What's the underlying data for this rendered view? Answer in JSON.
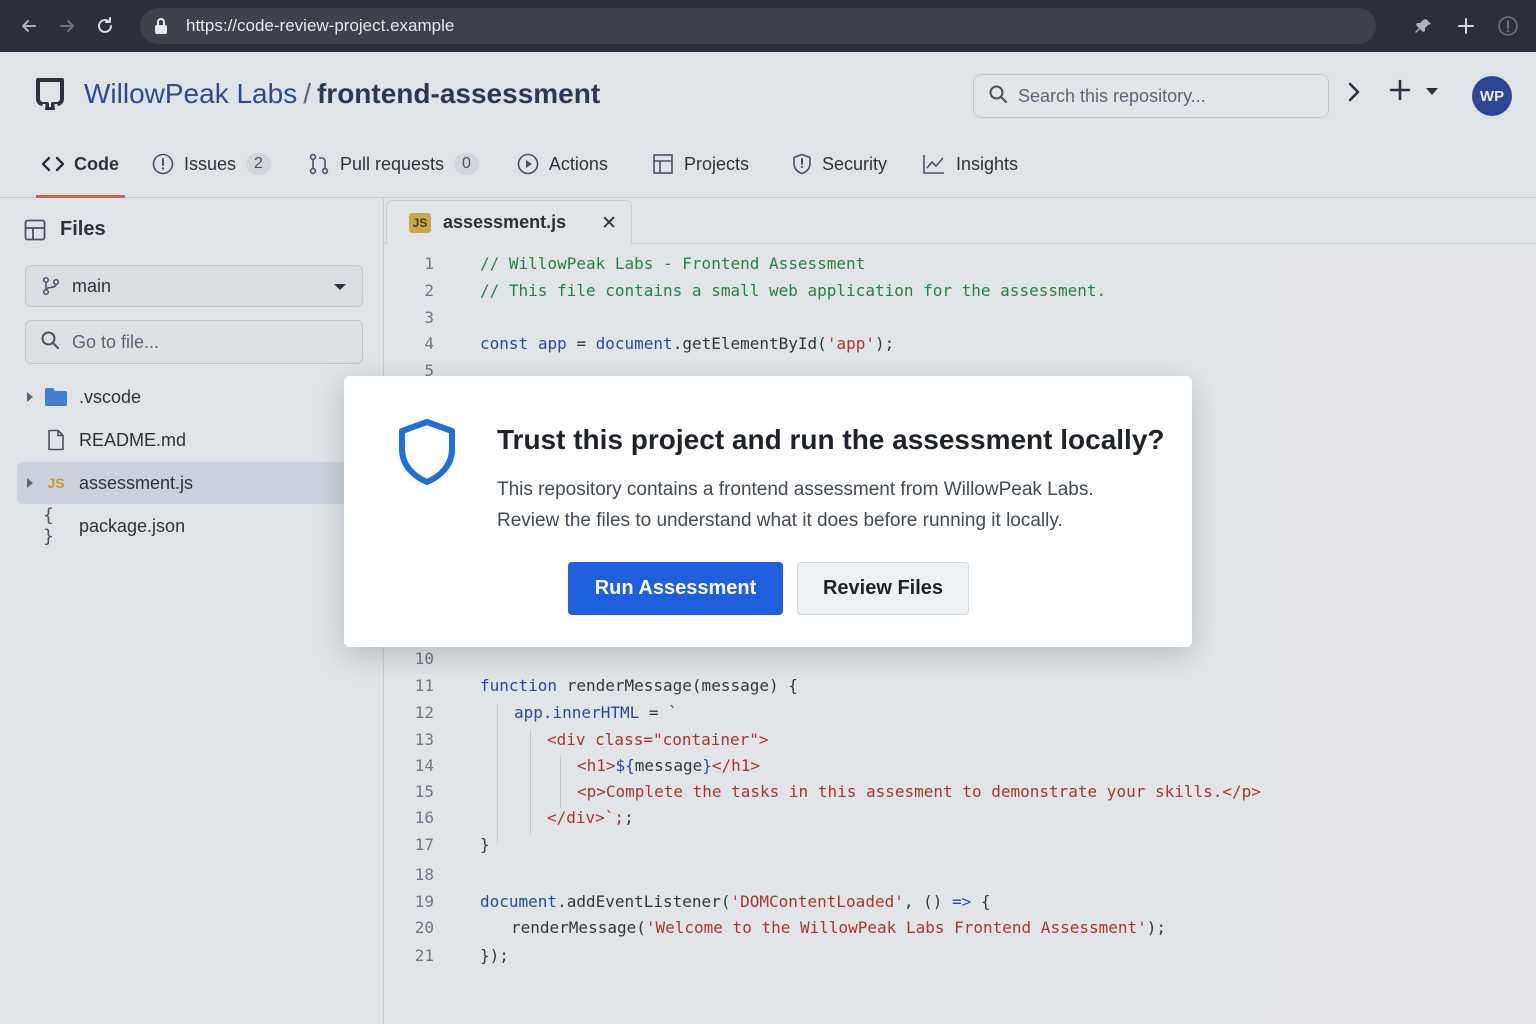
{
  "browser": {
    "url": "https://code-review-project.example",
    "icons": [
      "back-icon",
      "forward-icon",
      "reload-icon",
      "lock-icon",
      "pin-icon",
      "new-tab-icon",
      "info-icon"
    ]
  },
  "repo": {
    "owner": "WillowPeak Labs",
    "separator": "/",
    "name": "frontend-assessment",
    "search_placeholder": "Search this repository...",
    "avatar_initials": "WP"
  },
  "tabs": [
    {
      "label": "Code",
      "icon": "code-icon",
      "active": true
    },
    {
      "label": "Issues",
      "icon": "issue-icon",
      "count": "2"
    },
    {
      "label": "Pull requests",
      "icon": "pull-request-icon",
      "count": "0"
    },
    {
      "label": "Actions",
      "icon": "play-icon"
    },
    {
      "label": "Projects",
      "icon": "table-icon"
    },
    {
      "label": "Security",
      "icon": "shield-icon"
    },
    {
      "label": "Insights",
      "icon": "graph-icon"
    }
  ],
  "sidebar": {
    "title": "Files",
    "branch": "main",
    "goto_placeholder": "Go to file...",
    "tree": [
      {
        "name": ".vscode",
        "type": "folder"
      },
      {
        "name": "README.md",
        "type": "file"
      },
      {
        "name": "assessment.js",
        "type": "js",
        "selected": true
      },
      {
        "name": "package.json",
        "type": "json"
      }
    ]
  },
  "editor": {
    "tab_label": "assessment.js",
    "tab_badge": "JS",
    "close_glyph": "✕",
    "lines": [
      {
        "n": "1",
        "text": "// WillowPeak Labs - Frontend Assessment"
      },
      {
        "n": "2",
        "text": "// This file contains a small web application for the assessment."
      },
      {
        "n": "3",
        "text": ""
      },
      {
        "n": "4",
        "text": "const app = document.getElementById('app');"
      },
      {
        "n": "5",
        "text": ""
      },
      {
        "n": "10",
        "text": ""
      },
      {
        "n": "11",
        "text": "function renderMessage(message) {"
      },
      {
        "n": "12",
        "text": "app.innerHTML = `"
      },
      {
        "n": "13",
        "text": "<div class=\"container\">"
      },
      {
        "n": "14",
        "text": "<h1>${message}</h1>"
      },
      {
        "n": "15",
        "text": "<p>Complete the tasks in this assesment to demonstrate your skills.</p>"
      },
      {
        "n": "16",
        "text": "</div>`;"
      },
      {
        "n": "17",
        "text": "}"
      },
      {
        "n": "18",
        "text": ""
      },
      {
        "n": "19",
        "text": "document.addEventListener('DOMContentLoaded', () => {"
      },
      {
        "n": "20",
        "text": "renderMessage('Welcome to the WillowPeak Labs Frontend Assessment');"
      },
      {
        "n": "21",
        "text": "});"
      }
    ]
  },
  "modal": {
    "title": "Trust this project and run the assessment locally?",
    "body": "This repository contains a frontend assessment from WillowPeak Labs. Review the files to understand what it does before running it locally.",
    "primary_label": "Run Assessment",
    "secondary_label": "Review Files"
  },
  "colors": {
    "accent_blue": "#1f5fdb",
    "tab_underline": "#e05d44",
    "owner_link": "#243f8f",
    "avatar_bg": "#1f3a93",
    "shield": "#1f6fd6"
  }
}
